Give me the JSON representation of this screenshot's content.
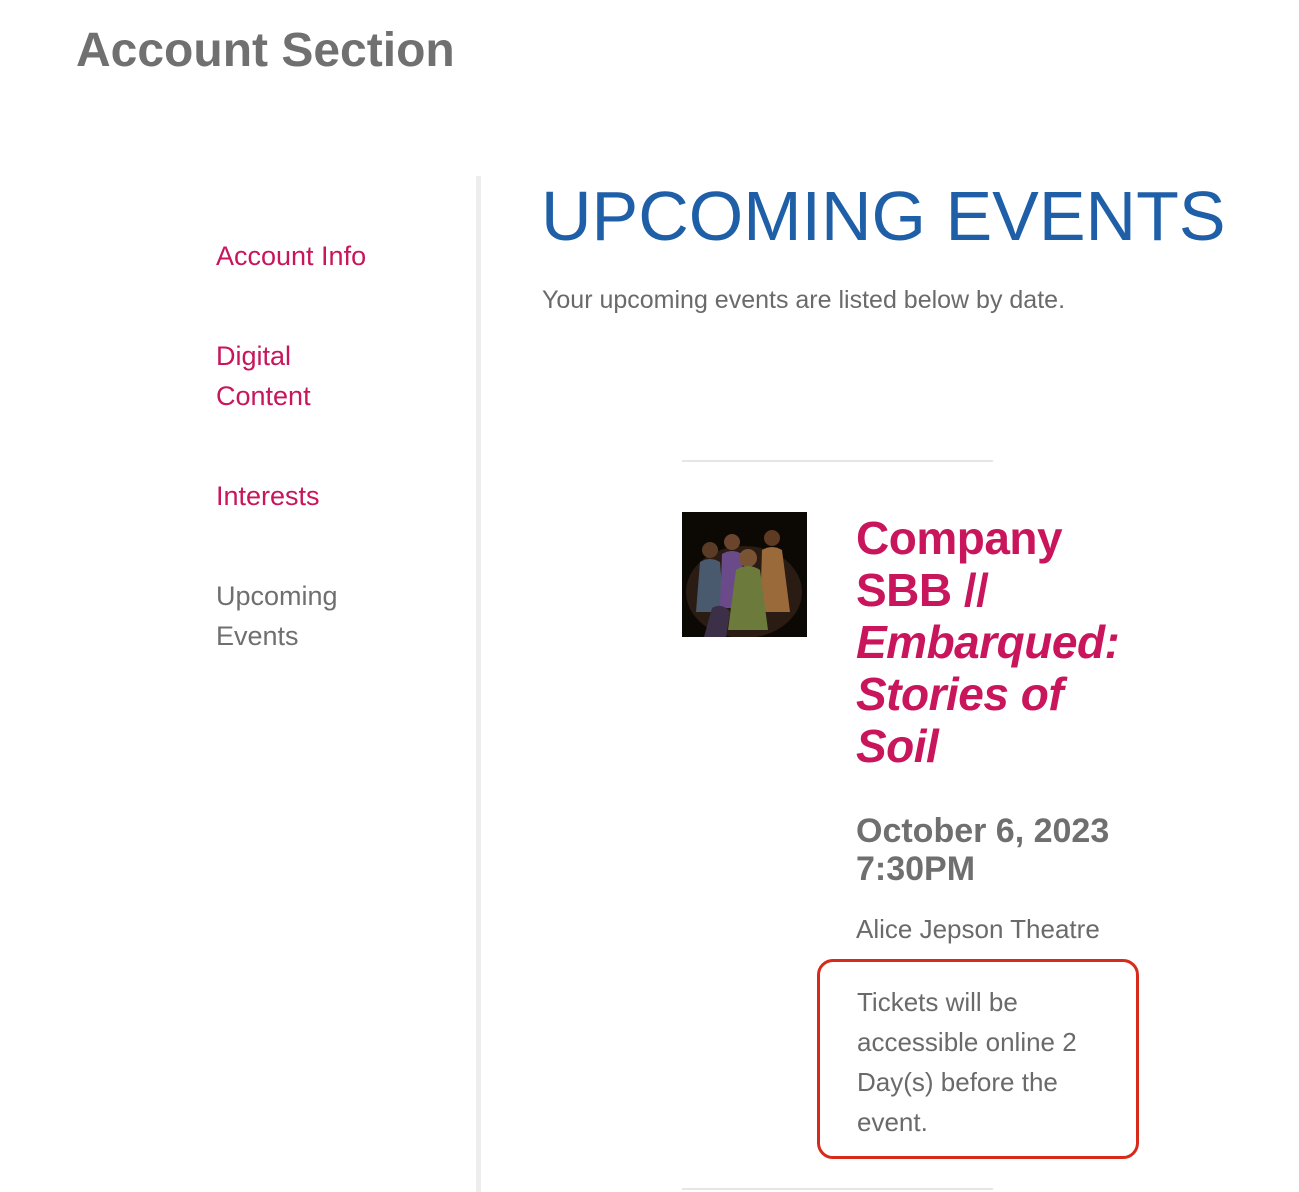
{
  "header": {
    "title": "Account Section"
  },
  "sidebar": {
    "items": [
      {
        "label": "Account Info"
      },
      {
        "label": "Digital Content"
      },
      {
        "label": "Interests"
      },
      {
        "label": "Upcoming Events"
      }
    ]
  },
  "main": {
    "heading": "UPCOMING EVENTS",
    "intro": "Your upcoming events are listed below by date.",
    "events": [
      {
        "title_prefix": "Company SBB // ",
        "title_subtitle": "Embarqued: Stories of Soil",
        "date": "October 6, 2023 7:30PM",
        "venue": "Alice Jepson Theatre",
        "ticket_note": "Tickets will be accessible online 2 Day(s) before the event."
      }
    ]
  },
  "colors": {
    "link": "#c8155b",
    "heading": "#1f5fa8",
    "muted_text": "#6f6f6f",
    "highlight_border": "#d82a1a"
  },
  "icons": {
    "event_thumbnail": "event-photo-dancers"
  }
}
